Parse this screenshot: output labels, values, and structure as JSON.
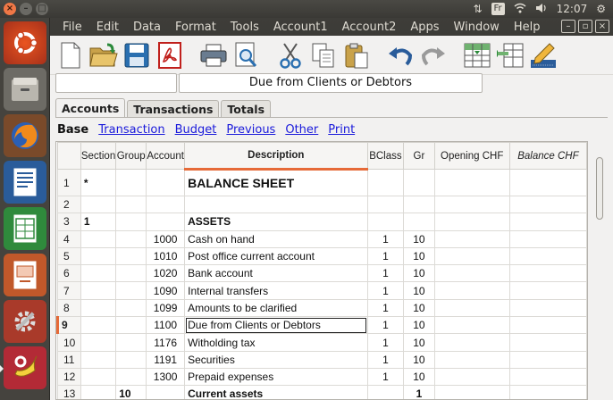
{
  "system": {
    "keyboard_layout": "Fr",
    "clock": "12:07"
  },
  "menu": [
    "File",
    "Edit",
    "Data",
    "Format",
    "Tools",
    "Account1",
    "Account2",
    "Apps",
    "Window",
    "Help"
  ],
  "toolbar": {
    "icons": [
      "new-file-icon",
      "open-folder-icon",
      "save-icon",
      "pdf-icon",
      "print-icon",
      "print-preview-icon",
      "cut-icon",
      "copy-icon",
      "paste-icon",
      "undo-icon",
      "redo-icon",
      "insert-row-icon",
      "delete-row-icon",
      "edit-pencil-icon"
    ]
  },
  "edit_field": {
    "value": "Due from Clients or Debtors"
  },
  "tabs": [
    "Accounts",
    "Transactions",
    "Totals"
  ],
  "views": {
    "current": "Base",
    "links": [
      "Transaction",
      "Budget",
      "Previous",
      "Other",
      "Print"
    ]
  },
  "table": {
    "headers": [
      "Section",
      "Group",
      "Account",
      "Description",
      "BClass",
      "Gr",
      "Opening CHF",
      "Balance CHF"
    ],
    "rows": [
      {
        "n": "1",
        "section": "*",
        "group": "",
        "account": "",
        "desc": "BALANCE SHEET",
        "bclass": "",
        "gr": "",
        "style": "big"
      },
      {
        "n": "2",
        "section": "",
        "group": "",
        "account": "",
        "desc": "",
        "bclass": "",
        "gr": ""
      },
      {
        "n": "3",
        "section": "1",
        "group": "",
        "account": "",
        "desc": "ASSETS",
        "bclass": "",
        "gr": "",
        "style": "bold"
      },
      {
        "n": "4",
        "section": "",
        "group": "",
        "account": "1000",
        "desc": "Cash on hand",
        "bclass": "1",
        "gr": "10"
      },
      {
        "n": "5",
        "section": "",
        "group": "",
        "account": "1010",
        "desc": "Post office current account",
        "bclass": "1",
        "gr": "10"
      },
      {
        "n": "6",
        "section": "",
        "group": "",
        "account": "1020",
        "desc": "Bank account",
        "bclass": "1",
        "gr": "10"
      },
      {
        "n": "7",
        "section": "",
        "group": "",
        "account": "1090",
        "desc": "Internal transfers",
        "bclass": "1",
        "gr": "10"
      },
      {
        "n": "8",
        "section": "",
        "group": "",
        "account": "1099",
        "desc": "Amounts to be clarified",
        "bclass": "1",
        "gr": "10"
      },
      {
        "n": "9",
        "section": "",
        "group": "",
        "account": "1100",
        "desc": "Due from Clients or Debtors",
        "bclass": "1",
        "gr": "10",
        "selected": true
      },
      {
        "n": "10",
        "section": "",
        "group": "",
        "account": "1176",
        "desc": "Witholding tax",
        "bclass": "1",
        "gr": "10"
      },
      {
        "n": "11",
        "section": "",
        "group": "",
        "account": "1191",
        "desc": "Securities",
        "bclass": "1",
        "gr": "10"
      },
      {
        "n": "12",
        "section": "",
        "group": "",
        "account": "1300",
        "desc": "Prepaid expenses",
        "bclass": "1",
        "gr": "10"
      },
      {
        "n": "13",
        "section": "",
        "group": "10",
        "account": "",
        "desc": "Current assets",
        "bclass": "",
        "gr": "1",
        "style": "bold"
      }
    ]
  },
  "colors": {
    "accent": "#e66a38",
    "link": "#1a1adb"
  }
}
